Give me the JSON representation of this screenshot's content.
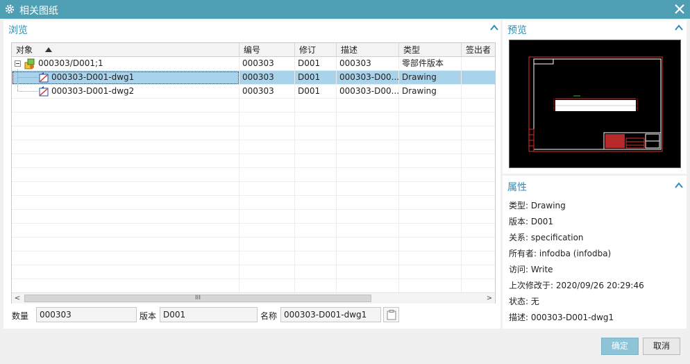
{
  "window": {
    "title": "相关图纸",
    "icon": "gear-icon",
    "close_icon": "close-icon"
  },
  "browse": {
    "title": "浏览",
    "columns": [
      "对象",
      "编号",
      "修订",
      "描述",
      "类型",
      "签出者"
    ],
    "rows": [
      {
        "object": "000303/D001;1",
        "number": "000303",
        "revision": "D001",
        "description": "000303",
        "type": "零部件版本",
        "checked_out_by": "",
        "icon": "item-revision-icon",
        "level": 0,
        "selected": false
      },
      {
        "object": "000303-D001-dwg1",
        "number": "000303",
        "revision": "D001",
        "description": "000303-D00...",
        "type": "Drawing",
        "checked_out_by": "",
        "icon": "drawing-icon",
        "level": 1,
        "selected": true
      },
      {
        "object": "000303-D001-dwg2",
        "number": "000303",
        "revision": "D001",
        "description": "000303-D00...",
        "type": "Drawing",
        "checked_out_by": "",
        "icon": "drawing-icon",
        "level": 1,
        "selected": false
      }
    ],
    "scroll_thumb_label": "III"
  },
  "fields": {
    "quantity_label": "数量",
    "quantity_value": "000303",
    "version_label": "版本",
    "version_value": "D001",
    "name_label": "名称",
    "name_value": "000303-D001-dwg1"
  },
  "preview": {
    "title": "预览"
  },
  "properties": {
    "title": "属性",
    "items": [
      "类型: Drawing",
      "版本: D001",
      "关系: specification",
      "所有者: infodba (infodba)",
      "访问: Write",
      "上次修改于: 2020/09/26 20:29:46",
      "状态: 无",
      "描述: 000303-D001-dwg1"
    ]
  },
  "buttons": {
    "ok": "确定",
    "cancel": "取消"
  },
  "colors": {
    "titlebar": "#4f9fb4",
    "accent": "#2a8db5",
    "selection": "#a9d3ea",
    "ok_button": "#8fc3d8"
  }
}
